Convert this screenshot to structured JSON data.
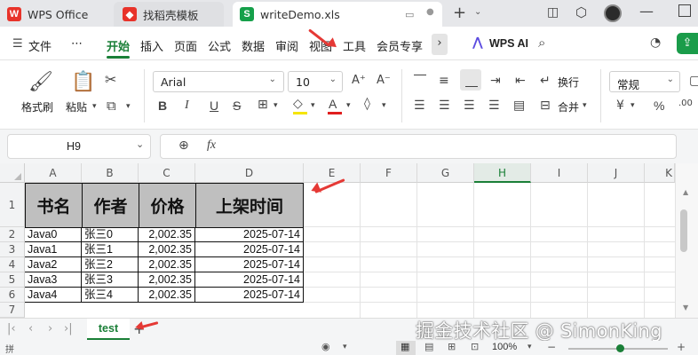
{
  "titlebar": {
    "tabs": [
      {
        "label": "WPS Office",
        "icon": "wps-logo-icon",
        "color": "#e8332a"
      },
      {
        "label": "找稻壳模板",
        "icon": "docer-icon",
        "color": "#e8332a"
      },
      {
        "label": "writeDemo.xls",
        "icon": "spreadsheet-icon",
        "badge": "S",
        "color": "#15a04a"
      }
    ]
  },
  "menubar": {
    "file": "文件",
    "more": "⋯",
    "items": [
      "开始",
      "插入",
      "页面",
      "公式",
      "数据",
      "审阅",
      "视图",
      "工具",
      "会员专享"
    ],
    "active_index": 0,
    "ai_label": "WPS AI"
  },
  "ribbon": {
    "format_painter": "格式刷",
    "paste": "粘贴",
    "font_name": "Arial",
    "font_size": "10",
    "wrap": "换行",
    "merge": "合并",
    "number_format": "常规",
    "currency": "¥",
    "percent": "%",
    "bold": "B",
    "italic": "I",
    "underline": "U",
    "strike": "S"
  },
  "formula": {
    "name_box": "H9",
    "fx": "fx",
    "value": ""
  },
  "grid": {
    "columns": [
      "A",
      "B",
      "C",
      "D",
      "E",
      "F",
      "G",
      "H",
      "I",
      "J",
      "K"
    ],
    "selected_column": "H",
    "rows": [
      "1",
      "2",
      "3",
      "4",
      "5",
      "6",
      "7"
    ],
    "headers": [
      "书名",
      "作者",
      "价格",
      "上架时间"
    ],
    "data": [
      [
        "Java0",
        "张三0",
        "2,002.35",
        "2025-07-14"
      ],
      [
        "Java1",
        "张三1",
        "2,002.35",
        "2025-07-14"
      ],
      [
        "Java2",
        "张三2",
        "2,002.35",
        "2025-07-14"
      ],
      [
        "Java3",
        "张三3",
        "2,002.35",
        "2025-07-14"
      ],
      [
        "Java4",
        "张三4",
        "2,002.35",
        "2025-07-14"
      ]
    ]
  },
  "sheets": {
    "tabs": [
      "test"
    ],
    "active": "test",
    "add": "+"
  },
  "status": {
    "left": "拼",
    "zoom": "100%"
  },
  "watermark": "掘金技术社区 @ SimonKing",
  "colors": {
    "accent": "#1a7f37",
    "header_fill": "#bfbfbf",
    "annotation": "#e53935"
  }
}
